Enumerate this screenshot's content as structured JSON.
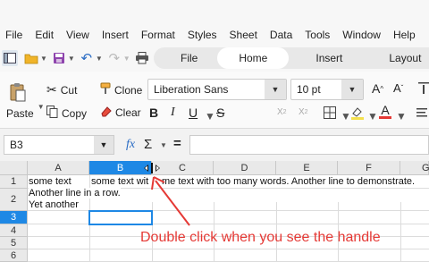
{
  "menu": [
    "File",
    "Edit",
    "View",
    "Insert",
    "Format",
    "Styles",
    "Sheet",
    "Data",
    "Tools",
    "Window",
    "Help"
  ],
  "tabs": [
    "File",
    "Home",
    "Insert",
    "Layout"
  ],
  "ribbon": {
    "paste": "Paste",
    "cut": "Cut",
    "copy": "Copy",
    "clone": "Clone",
    "clear": "Clear",
    "font_name": "Liberation Sans",
    "font_size": "10 pt"
  },
  "formula": {
    "name_box": "B3",
    "fx": "fx",
    "sigma": "Σ",
    "equals": "="
  },
  "columns": [
    "A",
    "B",
    "C",
    "D",
    "E",
    "F",
    "G"
  ],
  "rows": [
    "1",
    "2",
    "3",
    "4",
    "5",
    "6"
  ],
  "cells": {
    "a1": "some text",
    "b1": "some text wit",
    "c1": "me text with too many words. Another line to demonstrate.",
    "a2_line1": "Another line in a row.",
    "a2_line2": "Yet another"
  },
  "annotation": "Double click when you see the handle",
  "colors": {
    "accent": "#1e88e5",
    "annotation": "#e53935"
  }
}
